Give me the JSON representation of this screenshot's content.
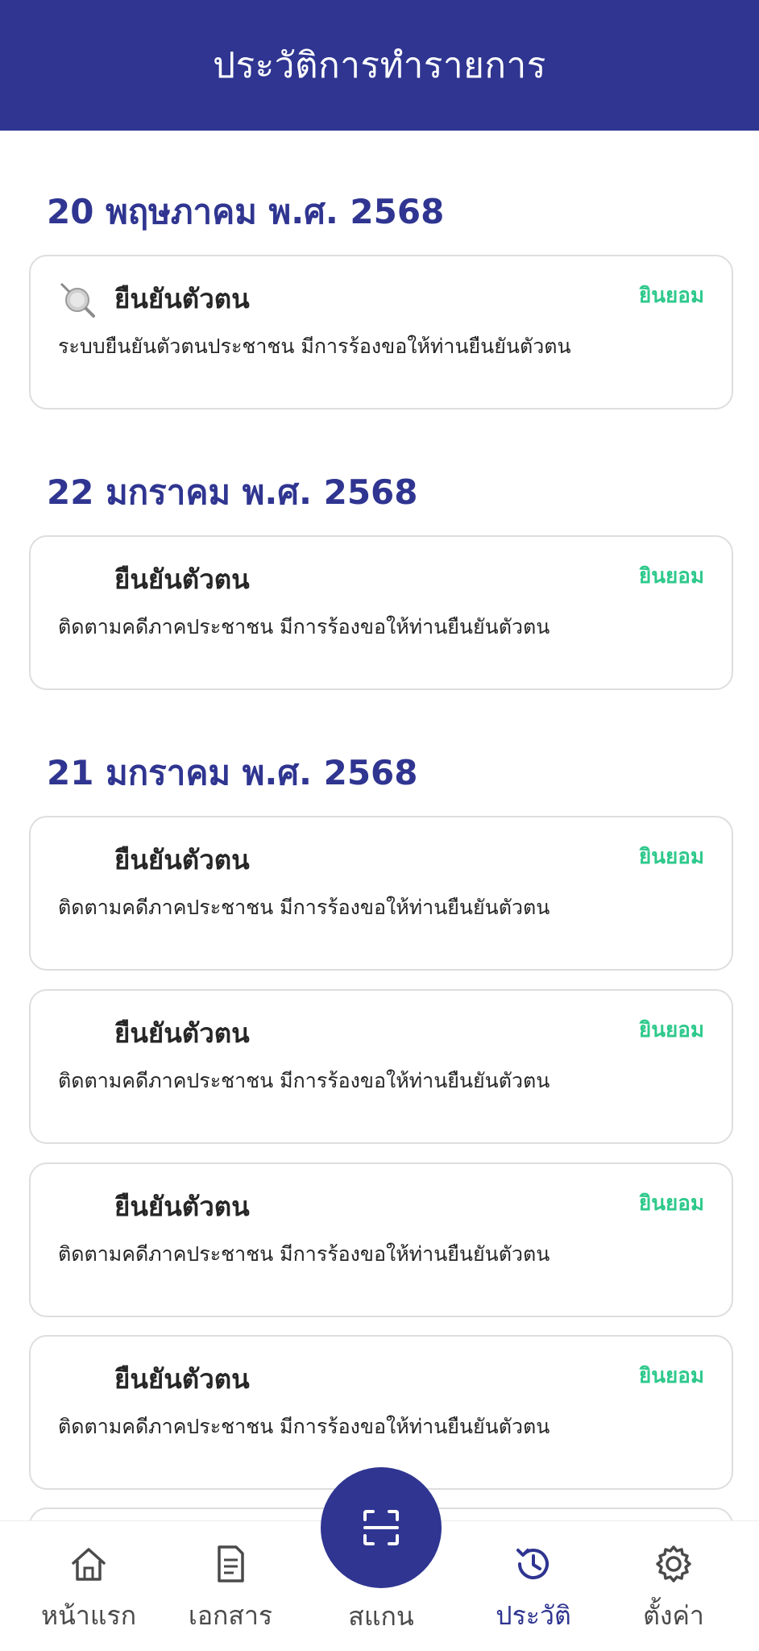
{
  "header": {
    "title": "ประวัติการทำรายการ"
  },
  "groups": [
    {
      "date": "20 พฤษภาคม พ.ศ. 2568",
      "items": [
        {
          "title": "ยืนยันตัวตน",
          "status": "ยินยอม",
          "description": "ระบบยืนยันตัวตนประชาชน มีการร้องขอให้ท่านยืนยันตัวตน",
          "icon": "magnifier-icon"
        }
      ]
    },
    {
      "date": "22 มกราคม พ.ศ. 2568",
      "items": [
        {
          "title": "ยืนยันตัวตน",
          "status": "ยินยอม",
          "description": "ติดตามคดีภาคประชาชน มีการร้องขอให้ท่านยืนยันตัวตน"
        }
      ]
    },
    {
      "date": "21 มกราคม พ.ศ. 2568",
      "items": [
        {
          "title": "ยืนยันตัวตน",
          "status": "ยินยอม",
          "description": "ติดตามคดีภาคประชาชน มีการร้องขอให้ท่านยืนยันตัวตน"
        },
        {
          "title": "ยืนยันตัวตน",
          "status": "ยินยอม",
          "description": "ติดตามคดีภาคประชาชน มีการร้องขอให้ท่านยืนยันตัวตน"
        },
        {
          "title": "ยืนยันตัวตน",
          "status": "ยินยอม",
          "description": "ติดตามคดีภาคประชาชน มีการร้องขอให้ท่านยืนยันตัวตน"
        },
        {
          "title": "ยืนยันตัวตน",
          "status": "ยินยอม",
          "description": "ติดตามคดีภาคประชาชน มีการร้องขอให้ท่านยืนยันตัวตน"
        }
      ]
    }
  ],
  "nav": {
    "items": [
      {
        "label": "หน้าแรก",
        "icon": "home-icon"
      },
      {
        "label": "เอกสาร",
        "icon": "document-icon"
      },
      {
        "label": "สแกน",
        "icon": "scan-icon"
      },
      {
        "label": "ประวัติ",
        "icon": "history-icon",
        "active": true
      },
      {
        "label": "ตั้งค่า",
        "icon": "gear-icon"
      }
    ]
  },
  "colors": {
    "brand": "#2f3590",
    "status_accept": "#2ec98b",
    "card_border": "#dedede"
  }
}
